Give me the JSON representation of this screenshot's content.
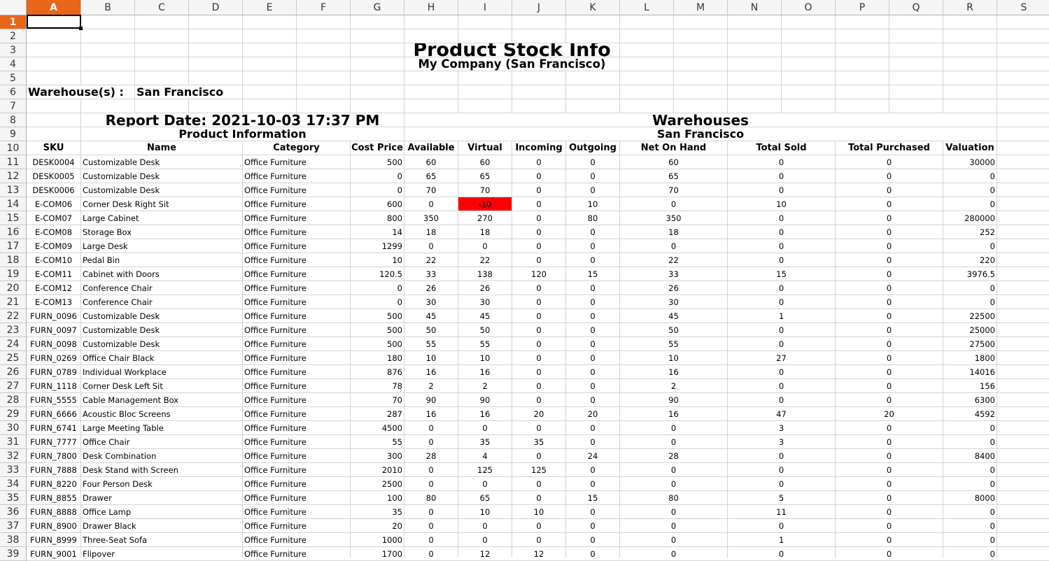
{
  "columns": [
    "A",
    "B",
    "C",
    "D",
    "E",
    "F",
    "G",
    "H",
    "I",
    "J",
    "K",
    "L",
    "M",
    "N",
    "O",
    "P",
    "Q",
    "R",
    "S"
  ],
  "selected_cell": "A1",
  "title": "Product Stock Info",
  "company": "My Company (San Francisco)",
  "warehouse_label": "Warehouse(s) :",
  "warehouse_value": "San Francisco",
  "report_date": "Report Date: 2021-10-03 17:37 PM",
  "product_info_header": "Product Information",
  "warehouses_header": "Warehouses",
  "warehouse_name": "San Francisco",
  "table_headers": [
    "SKU",
    "Name",
    "Category",
    "Cost Price",
    "Available",
    "Virtual",
    "Incoming",
    "Outgoing",
    "Net On Hand",
    "Total Sold",
    "Total Purchased",
    "Valuation"
  ],
  "highlight_color": "#ff0000",
  "rows": [
    [
      "DESK0004",
      "Customizable Desk",
      "Office Furniture",
      "500",
      "60",
      "60",
      "0",
      "0",
      "60",
      "0",
      "0",
      "30000"
    ],
    [
      "DESK0005",
      "Customizable Desk",
      "Office Furniture",
      "0",
      "65",
      "65",
      "0",
      "0",
      "65",
      "0",
      "0",
      "0"
    ],
    [
      "DESK0006",
      "Customizable Desk",
      "Office Furniture",
      "0",
      "70",
      "70",
      "0",
      "0",
      "70",
      "0",
      "0",
      "0"
    ],
    [
      "E-COM06",
      "Corner Desk Right Sit",
      "Office Furniture",
      "600",
      "0",
      "-10",
      "0",
      "10",
      "0",
      "10",
      "0",
      "0"
    ],
    [
      "E-COM07",
      "Large Cabinet",
      "Office Furniture",
      "800",
      "350",
      "270",
      "0",
      "80",
      "350",
      "0",
      "0",
      "280000"
    ],
    [
      "E-COM08",
      "Storage Box",
      "Office Furniture",
      "14",
      "18",
      "18",
      "0",
      "0",
      "18",
      "0",
      "0",
      "252"
    ],
    [
      "E-COM09",
      "Large Desk",
      "Office Furniture",
      "1299",
      "0",
      "0",
      "0",
      "0",
      "0",
      "0",
      "0",
      "0"
    ],
    [
      "E-COM10",
      "Pedal Bin",
      "Office Furniture",
      "10",
      "22",
      "22",
      "0",
      "0",
      "22",
      "0",
      "0",
      "220"
    ],
    [
      "E-COM11",
      "Cabinet with Doors",
      "Office Furniture",
      "120.5",
      "33",
      "138",
      "120",
      "15",
      "33",
      "15",
      "0",
      "3976.5"
    ],
    [
      "E-COM12",
      "Conference Chair",
      "Office Furniture",
      "0",
      "26",
      "26",
      "0",
      "0",
      "26",
      "0",
      "0",
      "0"
    ],
    [
      "E-COM13",
      "Conference Chair",
      "Office Furniture",
      "0",
      "30",
      "30",
      "0",
      "0",
      "30",
      "0",
      "0",
      "0"
    ],
    [
      "FURN_0096",
      "Customizable Desk",
      "Office Furniture",
      "500",
      "45",
      "45",
      "0",
      "0",
      "45",
      "1",
      "0",
      "22500"
    ],
    [
      "FURN_0097",
      "Customizable Desk",
      "Office Furniture",
      "500",
      "50",
      "50",
      "0",
      "0",
      "50",
      "0",
      "0",
      "25000"
    ],
    [
      "FURN_0098",
      "Customizable Desk",
      "Office Furniture",
      "500",
      "55",
      "55",
      "0",
      "0",
      "55",
      "0",
      "0",
      "27500"
    ],
    [
      "FURN_0269",
      "Office Chair Black",
      "Office Furniture",
      "180",
      "10",
      "10",
      "0",
      "0",
      "10",
      "27",
      "0",
      "1800"
    ],
    [
      "FURN_0789",
      "Individual Workplace",
      "Office Furniture",
      "876",
      "16",
      "16",
      "0",
      "0",
      "16",
      "0",
      "0",
      "14016"
    ],
    [
      "FURN_1118",
      "Corner Desk Left Sit",
      "Office Furniture",
      "78",
      "2",
      "2",
      "0",
      "0",
      "2",
      "0",
      "0",
      "156"
    ],
    [
      "FURN_5555",
      "Cable Management Box",
      "Office Furniture",
      "70",
      "90",
      "90",
      "0",
      "0",
      "90",
      "0",
      "0",
      "6300"
    ],
    [
      "FURN_6666",
      "Acoustic Bloc Screens",
      "Office Furniture",
      "287",
      "16",
      "16",
      "20",
      "20",
      "16",
      "47",
      "20",
      "4592"
    ],
    [
      "FURN_6741",
      "Large Meeting Table",
      "Office Furniture",
      "4500",
      "0",
      "0",
      "0",
      "0",
      "0",
      "3",
      "0",
      "0"
    ],
    [
      "FURN_7777",
      "Office Chair",
      "Office Furniture",
      "55",
      "0",
      "35",
      "35",
      "0",
      "0",
      "3",
      "0",
      "0"
    ],
    [
      "FURN_7800",
      "Desk Combination",
      "Office Furniture",
      "300",
      "28",
      "4",
      "0",
      "24",
      "28",
      "0",
      "0",
      "8400"
    ],
    [
      "FURN_7888",
      "Desk Stand with Screen",
      "Office Furniture",
      "2010",
      "0",
      "125",
      "125",
      "0",
      "0",
      "0",
      "0",
      "0"
    ],
    [
      "FURN_8220",
      "Four Person Desk",
      "Office Furniture",
      "2500",
      "0",
      "0",
      "0",
      "0",
      "0",
      "0",
      "0",
      "0"
    ],
    [
      "FURN_8855",
      "Drawer",
      "Office Furniture",
      "100",
      "80",
      "65",
      "0",
      "15",
      "80",
      "5",
      "0",
      "8000"
    ],
    [
      "FURN_8888",
      "Office Lamp",
      "Office Furniture",
      "35",
      "0",
      "10",
      "10",
      "0",
      "0",
      "11",
      "0",
      "0"
    ],
    [
      "FURN_8900",
      "Drawer Black",
      "Office Furniture",
      "20",
      "0",
      "0",
      "0",
      "0",
      "0",
      "0",
      "0",
      "0"
    ],
    [
      "FURN_8999",
      "Three-Seat Sofa",
      "Office Furniture",
      "1000",
      "0",
      "0",
      "0",
      "0",
      "0",
      "1",
      "0",
      "0"
    ],
    [
      "FURN_9001",
      "Flipover",
      "Office Furniture",
      "1700",
      "0",
      "12",
      "12",
      "0",
      "0",
      "0",
      "0",
      "0"
    ]
  ]
}
